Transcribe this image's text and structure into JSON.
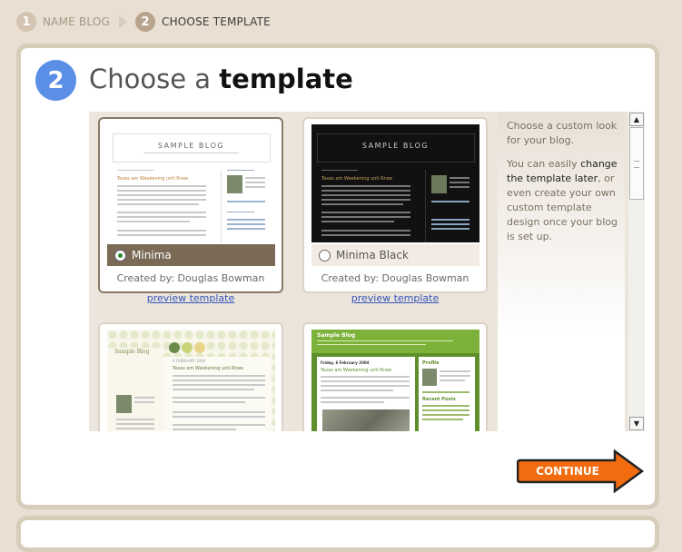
{
  "steps": [
    {
      "num": "1",
      "label": "NAME BLOG"
    },
    {
      "num": "2",
      "label": "CHOOSE TEMPLATE"
    }
  ],
  "header": {
    "num": "2",
    "title_pre": "Choose a",
    "title_bold": "template"
  },
  "templates": [
    {
      "name": "Minima",
      "credit": "Created by: Douglas Bowman",
      "preview": "preview template",
      "selected": true,
      "thumb_title": "SAMPLE BLOG",
      "thumb_heading": "Texas am Weekening unti Rnee"
    },
    {
      "name": "Minima Black",
      "credit": "Created by: Douglas Bowman",
      "preview": "preview template",
      "selected": false,
      "thumb_title": "SAMPLE BLOG",
      "thumb_heading": "Texas am Weekening unti Rnee"
    },
    {
      "name": "",
      "credit": "",
      "preview": "",
      "selected": false,
      "thumb_title": "Sample Blog",
      "thumb_heading": "Texas am Weekening unti Rnee",
      "thumb_date": "4 FEBRUARY 2004"
    },
    {
      "name": "",
      "credit": "",
      "preview": "",
      "selected": false,
      "thumb_title": "Sample Blog",
      "thumb_heading": "Texas am Weekening unti Rnee",
      "thumb_date": "Friday, 6 February 2004",
      "thumb_sidebar1": "Profile",
      "thumb_sidebar2": "Recent Posts"
    }
  ],
  "side": {
    "intro": "Choose a custom look for your blog.",
    "text1": "You can easily",
    "link": "change the template later",
    "text2": ", or even create your own custom template design once your blog is set up."
  },
  "continue_label": "CONTINUE",
  "colors": {
    "accent_blue": "#5b8ee6",
    "continue_orange": "#f26b0f",
    "panel_border": "#d8ccba",
    "selected_bar": "#7a6a56"
  }
}
